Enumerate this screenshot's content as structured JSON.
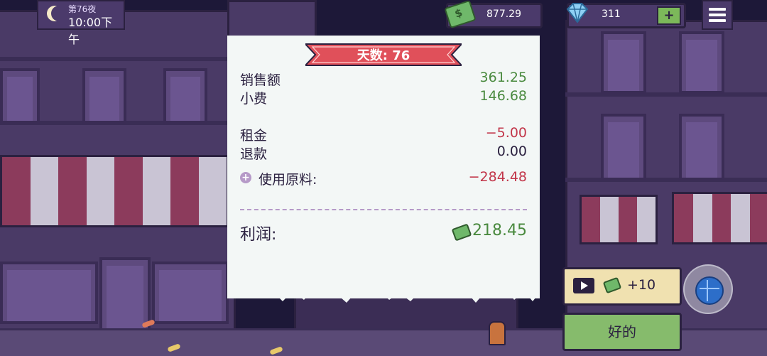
{
  "hud": {
    "day_night_label": "第76夜",
    "clock": "10:00下午",
    "money": "877.29",
    "gems": "311",
    "add_label": "+"
  },
  "receipt": {
    "day_banner": "天数: 76",
    "rows": [
      {
        "label": "销售额",
        "amount": "361.25"
      },
      {
        "label": "小费",
        "amount": "146.68"
      },
      {
        "label": "租金",
        "amount": "−5.00"
      },
      {
        "label": "退款",
        "amount": "0.00"
      },
      {
        "label": "使用原料:",
        "amount": "−284.48"
      }
    ],
    "profit_label": "利润:",
    "profit_amount": "218.45"
  },
  "buttons": {
    "ad_reward": "+10",
    "ok": "好的"
  },
  "colors": {
    "positive": "#4a8a3f",
    "negative": "#c2364a",
    "banner": "#e0505a"
  },
  "icons": [
    "moon-icon",
    "cash-icon",
    "gem-icon",
    "menu-icon",
    "play-icon",
    "globe-icon"
  ]
}
